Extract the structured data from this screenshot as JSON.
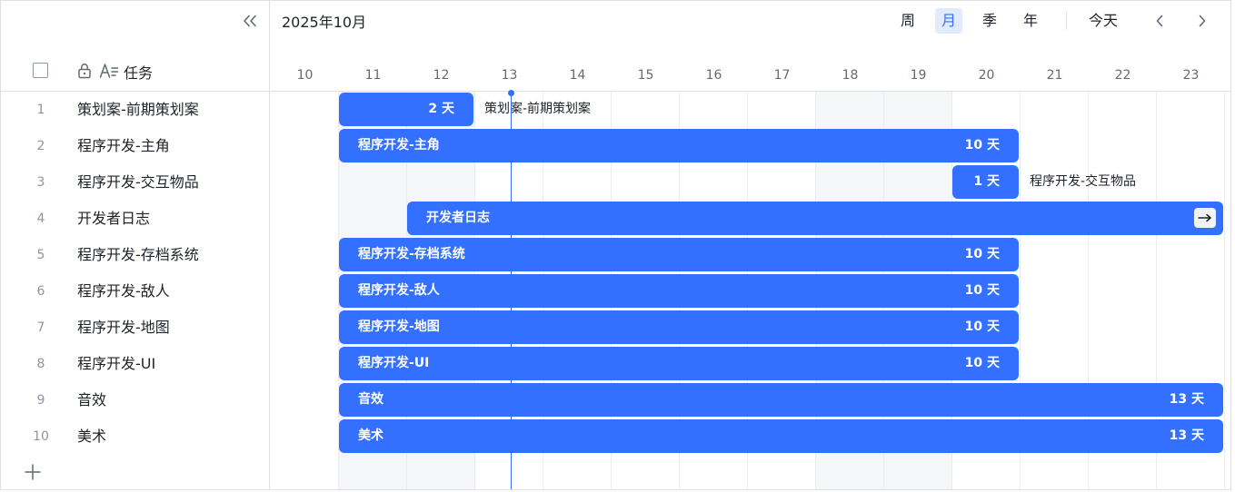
{
  "toolbar": {
    "month_label": "2025年10月",
    "views": [
      {
        "label": "周",
        "active": false
      },
      {
        "label": "月",
        "active": true
      },
      {
        "label": "季",
        "active": false
      },
      {
        "label": "年",
        "active": false
      }
    ],
    "today_label": "今天",
    "icons": {
      "collapse": "double-chevron-left-icon",
      "prev": "chevron-left-icon",
      "next": "chevron-right-icon"
    }
  },
  "left_panel": {
    "header_label": "任务",
    "add_icon": "plus-icon"
  },
  "timeline": {
    "days": [
      "10",
      "11",
      "12",
      "13",
      "14",
      "15",
      "16",
      "17",
      "18",
      "19",
      "20",
      "21",
      "22",
      "23"
    ],
    "weekend_days": [
      "11",
      "12",
      "18",
      "19"
    ],
    "today": "13"
  },
  "tasks": [
    {
      "num": "1",
      "name": "策划案-前期策划案",
      "start": "11",
      "days": 2,
      "duration_label": "2 天",
      "bar_label": "",
      "outside_label": "策划案-前期策划案",
      "overflow": false
    },
    {
      "num": "2",
      "name": "程序开发-主角",
      "start": "11",
      "days": 10,
      "duration_label": "10 天",
      "bar_label": "程序开发-主角",
      "outside_label": "",
      "overflow": false
    },
    {
      "num": "3",
      "name": "程序开发-交互物品",
      "start": "20",
      "days": 1,
      "duration_label": "1 天",
      "bar_label": "",
      "outside_label": "程序开发-交互物品",
      "overflow": false
    },
    {
      "num": "4",
      "name": "开发者日志",
      "start": "12",
      "days": 13,
      "duration_label": "",
      "bar_label": "开发者日志",
      "outside_label": "",
      "overflow": true
    },
    {
      "num": "5",
      "name": "程序开发-存档系统",
      "start": "11",
      "days": 10,
      "duration_label": "10 天",
      "bar_label": "程序开发-存档系统",
      "outside_label": "",
      "overflow": false
    },
    {
      "num": "6",
      "name": "程序开发-敌人",
      "start": "11",
      "days": 10,
      "duration_label": "10 天",
      "bar_label": "程序开发-敌人",
      "outside_label": "",
      "overflow": false
    },
    {
      "num": "7",
      "name": "程序开发-地图",
      "start": "11",
      "days": 10,
      "duration_label": "10 天",
      "bar_label": "程序开发-地图",
      "outside_label": "",
      "overflow": false
    },
    {
      "num": "8",
      "name": "程序开发-UI",
      "start": "11",
      "days": 10,
      "duration_label": "10 天",
      "bar_label": "程序开发-UI",
      "outside_label": "",
      "overflow": false
    },
    {
      "num": "9",
      "name": "音效",
      "start": "11",
      "days": 13,
      "duration_label": "13 天",
      "bar_label": "音效",
      "outside_label": "",
      "overflow": false
    },
    {
      "num": "10",
      "name": "美术",
      "start": "11",
      "days": 13,
      "duration_label": "13 天",
      "bar_label": "美术",
      "outside_label": "",
      "overflow": false
    }
  ],
  "colors": {
    "bar": "#3370ff",
    "weekend": "#f5f6f7",
    "today_line": "#3370ff",
    "active_view_bg": "#e1eaff"
  }
}
